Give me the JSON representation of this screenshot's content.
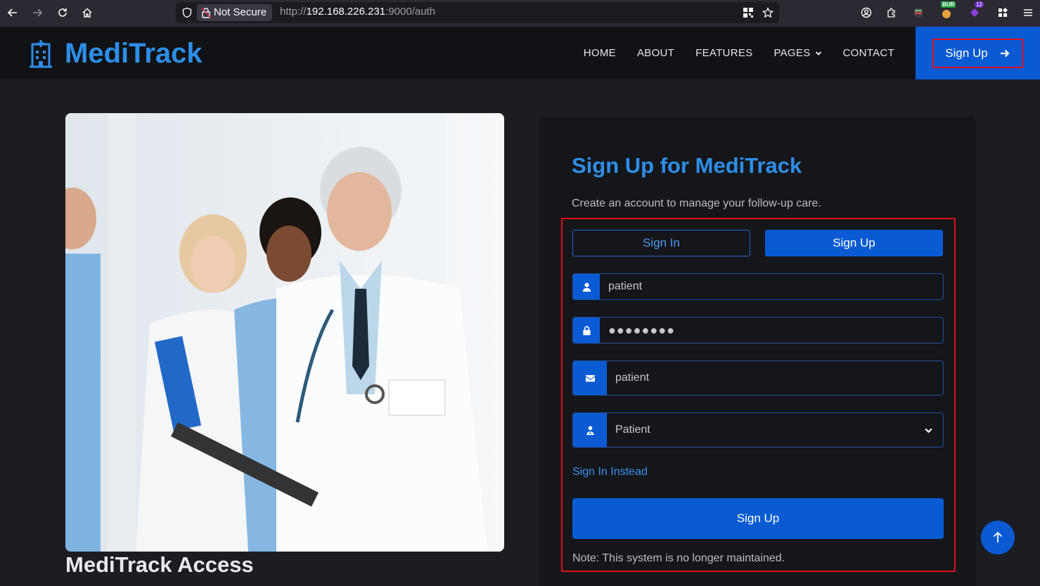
{
  "browser": {
    "security_label": "Not Secure",
    "url_prefix": "http://",
    "url_host": "192.168.226.231",
    "url_rest": ":9000/auth",
    "ext_badge_bur": "BUR",
    "ext_badge_count": "12"
  },
  "header": {
    "brand": "MediTrack",
    "menu": [
      "HOME",
      "ABOUT",
      "FEATURES",
      "PAGES",
      "CONTACT"
    ],
    "cta_label": "Sign Up"
  },
  "hero": {
    "caption": "MediTrack Access"
  },
  "auth": {
    "title": "Sign Up for MediTrack",
    "subtitle": "Create an account to manage your follow-up care.",
    "tab_signin": "Sign In",
    "tab_signup": "Sign Up",
    "username_value": "patient",
    "password_mask": "●●●●●●●●",
    "email_value": "patient",
    "role_value": "Patient",
    "switch_link": "Sign In Instead",
    "submit_label": "Sign Up",
    "note": "Note: This system is no longer maintained."
  },
  "colors": {
    "brand": "#2d8ee8",
    "primary": "#0a5bd3",
    "highlight": "#e0101a"
  }
}
